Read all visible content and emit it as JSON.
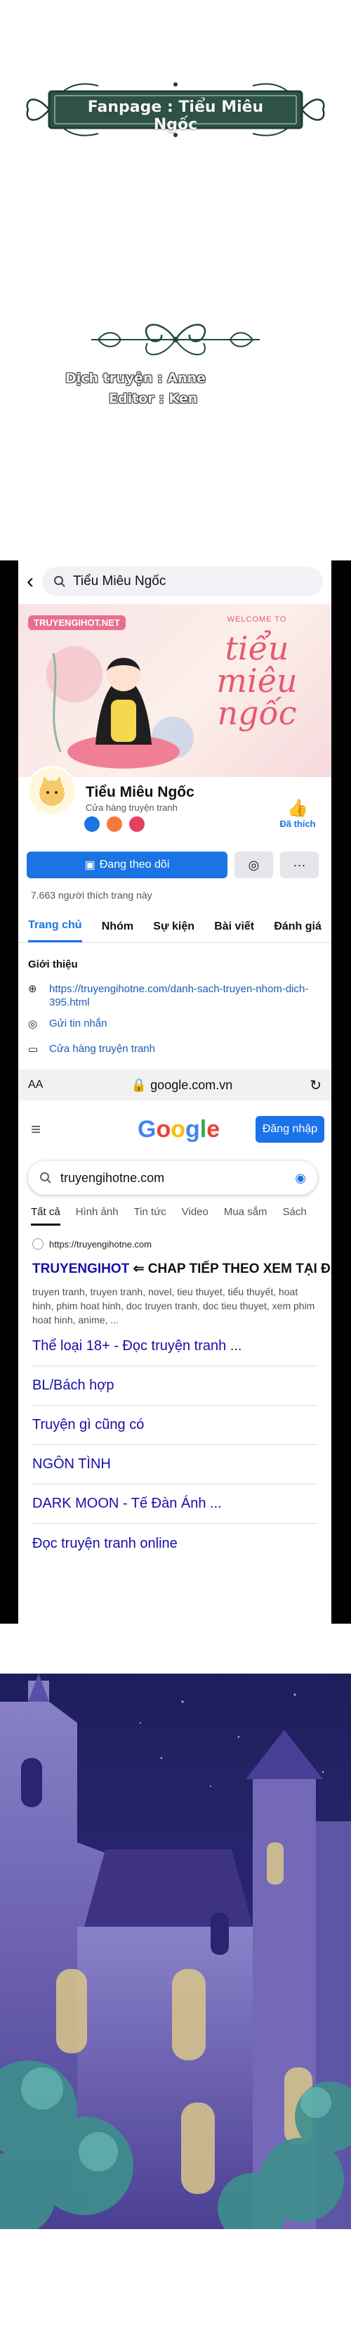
{
  "credits": {
    "fanpage": "Fanpage : Tiểu Miêu Ngốc",
    "translator": "Dịch truyện : Anne",
    "editor": "Editor : Ken"
  },
  "facebook": {
    "search_value": "Tiểu Miêu Ngốc",
    "cover": {
      "brand": "TRUYENGIHOT.NET",
      "welcome": "WELCOME TO",
      "title": "tiểu miêu ngốc"
    },
    "page_name": "Tiểu Miêu Ngốc",
    "category": "Cửa hàng truyện tranh",
    "liked_label": "Đã thích",
    "follow_label": "Đang theo dõi",
    "more_label": "···",
    "likes_text": "7.663 người thích trang này",
    "tabs": [
      "Trang chủ",
      "Nhóm",
      "Sự kiện",
      "Bài viết",
      "Đánh giá"
    ],
    "intro_title": "Giới thiệu",
    "intro_link": "https://truyengihotne.com/danh-sach-truyen-nhom-dich-395.html",
    "intro_message": "Gửi tin nhắn",
    "intro_shop": "Cửa hàng truyện tranh"
  },
  "browser": {
    "aa": "AA",
    "url": "google.com.vn"
  },
  "google": {
    "logo_letters": [
      {
        "ch": "G",
        "color": "#4285F4"
      },
      {
        "ch": "o",
        "color": "#EA4335"
      },
      {
        "ch": "o",
        "color": "#FBBC05"
      },
      {
        "ch": "g",
        "color": "#4285F4"
      },
      {
        "ch": "l",
        "color": "#34A853"
      },
      {
        "ch": "e",
        "color": "#EA4335"
      }
    ],
    "signin_label": "Đăng nhập",
    "query": "truyengihotne.com",
    "tabs": [
      "Tất cả",
      "Hình ảnh",
      "Tin tức",
      "Video",
      "Mua sắm",
      "Sách"
    ],
    "result": {
      "site": "https://truyengihotne.com",
      "title_a": "TRUYENGIHOT",
      "title_b": "⇐ CHAP TIẾP THEO XEM TẠI ĐÂY NHA",
      "description": "truyen tranh, truyen tranh, novel, tieu thuyet, tiểu thuyết, hoat hinh, phim hoat hinh, doc truyen tranh, doc tieu thuyet, xem phim hoat hinh, anime, ..."
    },
    "sitelinks": [
      "Thể loại 18+ - Đọc truyện tranh ...",
      "BL/Bách hợp",
      "Truyện gì cũng có",
      "NGÔN TÌNH",
      "DARK MOON - Tế Đàn Ánh ...",
      "Đọc truyện tranh online"
    ]
  }
}
